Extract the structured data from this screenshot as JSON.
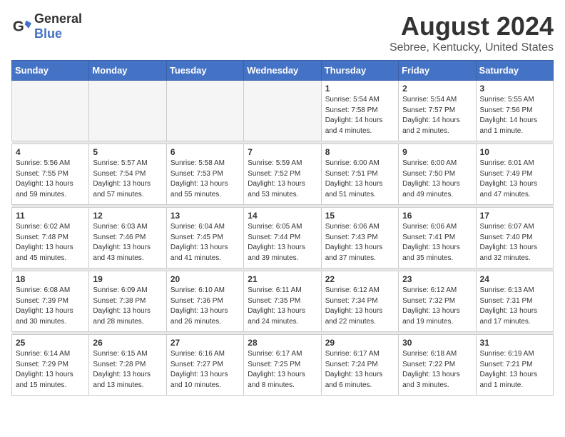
{
  "logo": {
    "text_general": "General",
    "text_blue": "Blue"
  },
  "title": "August 2024",
  "subtitle": "Sebree, Kentucky, United States",
  "days_of_week": [
    "Sunday",
    "Monday",
    "Tuesday",
    "Wednesday",
    "Thursday",
    "Friday",
    "Saturday"
  ],
  "weeks": [
    [
      {
        "day": "",
        "info": ""
      },
      {
        "day": "",
        "info": ""
      },
      {
        "day": "",
        "info": ""
      },
      {
        "day": "",
        "info": ""
      },
      {
        "day": "1",
        "info": "Sunrise: 5:54 AM\nSunset: 7:58 PM\nDaylight: 14 hours\nand 4 minutes."
      },
      {
        "day": "2",
        "info": "Sunrise: 5:54 AM\nSunset: 7:57 PM\nDaylight: 14 hours\nand 2 minutes."
      },
      {
        "day": "3",
        "info": "Sunrise: 5:55 AM\nSunset: 7:56 PM\nDaylight: 14 hours\nand 1 minute."
      }
    ],
    [
      {
        "day": "4",
        "info": "Sunrise: 5:56 AM\nSunset: 7:55 PM\nDaylight: 13 hours\nand 59 minutes."
      },
      {
        "day": "5",
        "info": "Sunrise: 5:57 AM\nSunset: 7:54 PM\nDaylight: 13 hours\nand 57 minutes."
      },
      {
        "day": "6",
        "info": "Sunrise: 5:58 AM\nSunset: 7:53 PM\nDaylight: 13 hours\nand 55 minutes."
      },
      {
        "day": "7",
        "info": "Sunrise: 5:59 AM\nSunset: 7:52 PM\nDaylight: 13 hours\nand 53 minutes."
      },
      {
        "day": "8",
        "info": "Sunrise: 6:00 AM\nSunset: 7:51 PM\nDaylight: 13 hours\nand 51 minutes."
      },
      {
        "day": "9",
        "info": "Sunrise: 6:00 AM\nSunset: 7:50 PM\nDaylight: 13 hours\nand 49 minutes."
      },
      {
        "day": "10",
        "info": "Sunrise: 6:01 AM\nSunset: 7:49 PM\nDaylight: 13 hours\nand 47 minutes."
      }
    ],
    [
      {
        "day": "11",
        "info": "Sunrise: 6:02 AM\nSunset: 7:48 PM\nDaylight: 13 hours\nand 45 minutes."
      },
      {
        "day": "12",
        "info": "Sunrise: 6:03 AM\nSunset: 7:46 PM\nDaylight: 13 hours\nand 43 minutes."
      },
      {
        "day": "13",
        "info": "Sunrise: 6:04 AM\nSunset: 7:45 PM\nDaylight: 13 hours\nand 41 minutes."
      },
      {
        "day": "14",
        "info": "Sunrise: 6:05 AM\nSunset: 7:44 PM\nDaylight: 13 hours\nand 39 minutes."
      },
      {
        "day": "15",
        "info": "Sunrise: 6:06 AM\nSunset: 7:43 PM\nDaylight: 13 hours\nand 37 minutes."
      },
      {
        "day": "16",
        "info": "Sunrise: 6:06 AM\nSunset: 7:41 PM\nDaylight: 13 hours\nand 35 minutes."
      },
      {
        "day": "17",
        "info": "Sunrise: 6:07 AM\nSunset: 7:40 PM\nDaylight: 13 hours\nand 32 minutes."
      }
    ],
    [
      {
        "day": "18",
        "info": "Sunrise: 6:08 AM\nSunset: 7:39 PM\nDaylight: 13 hours\nand 30 minutes."
      },
      {
        "day": "19",
        "info": "Sunrise: 6:09 AM\nSunset: 7:38 PM\nDaylight: 13 hours\nand 28 minutes."
      },
      {
        "day": "20",
        "info": "Sunrise: 6:10 AM\nSunset: 7:36 PM\nDaylight: 13 hours\nand 26 minutes."
      },
      {
        "day": "21",
        "info": "Sunrise: 6:11 AM\nSunset: 7:35 PM\nDaylight: 13 hours\nand 24 minutes."
      },
      {
        "day": "22",
        "info": "Sunrise: 6:12 AM\nSunset: 7:34 PM\nDaylight: 13 hours\nand 22 minutes."
      },
      {
        "day": "23",
        "info": "Sunrise: 6:12 AM\nSunset: 7:32 PM\nDaylight: 13 hours\nand 19 minutes."
      },
      {
        "day": "24",
        "info": "Sunrise: 6:13 AM\nSunset: 7:31 PM\nDaylight: 13 hours\nand 17 minutes."
      }
    ],
    [
      {
        "day": "25",
        "info": "Sunrise: 6:14 AM\nSunset: 7:29 PM\nDaylight: 13 hours\nand 15 minutes."
      },
      {
        "day": "26",
        "info": "Sunrise: 6:15 AM\nSunset: 7:28 PM\nDaylight: 13 hours\nand 13 minutes."
      },
      {
        "day": "27",
        "info": "Sunrise: 6:16 AM\nSunset: 7:27 PM\nDaylight: 13 hours\nand 10 minutes."
      },
      {
        "day": "28",
        "info": "Sunrise: 6:17 AM\nSunset: 7:25 PM\nDaylight: 13 hours\nand 8 minutes."
      },
      {
        "day": "29",
        "info": "Sunrise: 6:17 AM\nSunset: 7:24 PM\nDaylight: 13 hours\nand 6 minutes."
      },
      {
        "day": "30",
        "info": "Sunrise: 6:18 AM\nSunset: 7:22 PM\nDaylight: 13 hours\nand 3 minutes."
      },
      {
        "day": "31",
        "info": "Sunrise: 6:19 AM\nSunset: 7:21 PM\nDaylight: 13 hours\nand 1 minute."
      }
    ]
  ]
}
